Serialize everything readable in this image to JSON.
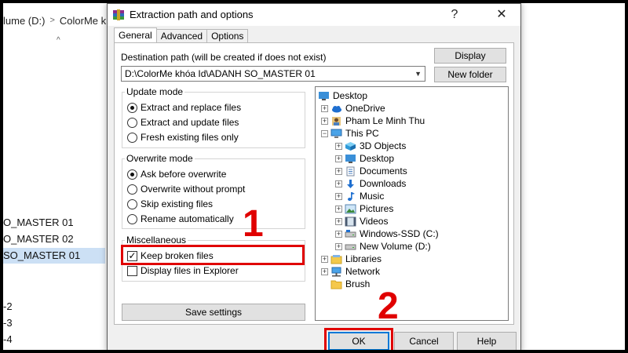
{
  "background": {
    "address": {
      "drive": "lume (D:)",
      "folder": "ColorMe kh"
    },
    "rows": [
      "O_MASTER 01",
      "O_MASTER 02",
      "SO_MASTER 01"
    ],
    "selected_row_index": 2,
    "numbers": [
      "-2",
      "-3",
      "-4"
    ]
  },
  "dialog": {
    "title": "Extraction path and options",
    "help_btn": "?",
    "close_btn": "✕",
    "tabs": [
      {
        "label": "General",
        "active": true
      },
      {
        "label": "Advanced",
        "active": false
      },
      {
        "label": "Options",
        "active": false
      }
    ],
    "destination_label": "Destination path (will be created if does not exist)",
    "destination_value": "D:\\ColorMe khóa Id\\ADANH SO_MASTER 01",
    "display_btn": "Display",
    "new_folder_btn": "New folder",
    "update_mode": {
      "legend": "Update mode",
      "options": [
        {
          "label": "Extract and replace files",
          "selected": true
        },
        {
          "label": "Extract and update files",
          "selected": false
        },
        {
          "label": "Fresh existing files only",
          "selected": false
        }
      ]
    },
    "overwrite_mode": {
      "legend": "Overwrite mode",
      "options": [
        {
          "label": "Ask before overwrite",
          "selected": true
        },
        {
          "label": "Overwrite without prompt",
          "selected": false
        },
        {
          "label": "Skip existing files",
          "selected": false
        },
        {
          "label": "Rename automatically",
          "selected": false
        }
      ]
    },
    "misc": {
      "legend": "Miscellaneous",
      "options": [
        {
          "label": "Keep broken files",
          "checked": true
        },
        {
          "label": "Display files in Explorer",
          "checked": false
        }
      ]
    },
    "save_settings_btn": "Save settings",
    "tree": [
      {
        "label": "Desktop",
        "icon": "desktop-icon",
        "expander": "none",
        "level": 0
      },
      {
        "label": "OneDrive",
        "icon": "cloud-icon",
        "expander": "plus",
        "level": 1
      },
      {
        "label": "Pham Le Minh Thu",
        "icon": "user-icon",
        "expander": "plus",
        "level": 1
      },
      {
        "label": "This PC",
        "icon": "pc-icon",
        "expander": "minus",
        "level": 1
      },
      {
        "label": "3D Objects",
        "icon": "cube-icon",
        "expander": "plus",
        "level": 2
      },
      {
        "label": "Desktop",
        "icon": "desktop-icon",
        "expander": "plus",
        "level": 2
      },
      {
        "label": "Documents",
        "icon": "documents-icon",
        "expander": "plus",
        "level": 2
      },
      {
        "label": "Downloads",
        "icon": "download-icon",
        "expander": "plus",
        "level": 2
      },
      {
        "label": "Music",
        "icon": "music-icon",
        "expander": "plus",
        "level": 2
      },
      {
        "label": "Pictures",
        "icon": "pictures-icon",
        "expander": "plus",
        "level": 2
      },
      {
        "label": "Videos",
        "icon": "videos-icon",
        "expander": "plus",
        "level": 2
      },
      {
        "label": "Windows-SSD (C:)",
        "icon": "drive-icon",
        "expander": "plus",
        "level": 2
      },
      {
        "label": "New Volume (D:)",
        "icon": "drive-icon",
        "expander": "plus",
        "level": 2
      },
      {
        "label": "Libraries",
        "icon": "libraries-icon",
        "expander": "plus",
        "level": 1
      },
      {
        "label": "Network",
        "icon": "network-icon",
        "expander": "plus",
        "level": 1
      },
      {
        "label": "Brush",
        "icon": "folder-icon",
        "expander": "none",
        "level": 1
      }
    ],
    "ok_btn": "OK",
    "cancel_btn": "Cancel",
    "help_button": "Help"
  },
  "annotations": {
    "step1": "1",
    "step2": "2"
  },
  "colors": {
    "annotation_red": "#e00000",
    "selection_blue": "#cce0f5",
    "focus_blue": "#0078d7"
  }
}
